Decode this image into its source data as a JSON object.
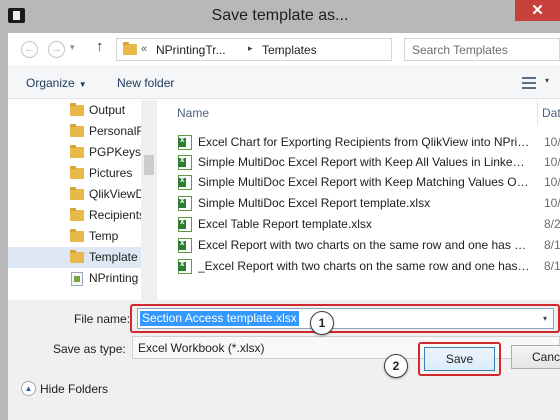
{
  "window": {
    "title": "Save template as...",
    "close_glyph": "✕"
  },
  "addressbar": {
    "back_glyph": "←",
    "forward_glyph": "→",
    "recent_glyph": "▾",
    "up_glyph": "↑",
    "overflow": "«",
    "crumbs": [
      "NPrintingTr...",
      "Templates"
    ],
    "crumb_separator": "▸",
    "dropdown_glyph": "▾",
    "refresh_glyph": "↻",
    "search_placeholder": "Search Templates"
  },
  "toolbar": {
    "organize_label": "Organize",
    "organize_caret": "▼",
    "new_folder_label": "New folder",
    "view_caret": "▾"
  },
  "nav_pane": {
    "items": [
      {
        "label": "Output",
        "icon": "folder-icon",
        "selected": false
      },
      {
        "label": "PersonalF",
        "icon": "folder-icon",
        "selected": false
      },
      {
        "label": "PGPKeys",
        "icon": "folder-icon",
        "selected": false
      },
      {
        "label": "Pictures",
        "icon": "folder-icon",
        "selected": false
      },
      {
        "label": "QlikViewD",
        "icon": "folder-icon",
        "selected": false
      },
      {
        "label": "Recipients",
        "icon": "folder-icon",
        "selected": false
      },
      {
        "label": "Temp",
        "icon": "folder-icon",
        "selected": false
      },
      {
        "label": "Template",
        "icon": "folder-icon",
        "selected": true
      },
      {
        "label": "NPrinting",
        "icon": "nprinting-file-icon",
        "selected": false
      }
    ]
  },
  "file_list": {
    "columns": {
      "name": "Name",
      "date": "Dat"
    },
    "files": [
      {
        "name": "Excel Chart for Exporting Recipients from QlikView into NPrin...",
        "date": "10/"
      },
      {
        "name": "Simple MultiDoc Excel Report with Keep All Values in Linked ...",
        "date": "10/"
      },
      {
        "name": "Simple MultiDoc Excel Report with Keep Matching Values Onl...",
        "date": "10/"
      },
      {
        "name": "Simple MultiDoc Excel Report template.xlsx",
        "date": "10/"
      },
      {
        "name": "Excel Table Report template.xlsx",
        "date": "8/2"
      },
      {
        "name": "Excel Report with two charts on the same row and one has ex...",
        "date": "8/1"
      },
      {
        "name": "_Excel Report with two charts on the same row and one has e...",
        "date": "8/1"
      }
    ]
  },
  "form": {
    "file_name_label": "File name:",
    "file_name_value": "Section Access template.xlsx",
    "file_name_caret": "▾",
    "save_as_type_label": "Save as type:",
    "save_as_type_value": "Excel Workbook (*.xlsx)",
    "callout_1": "1",
    "callout_2": "2"
  },
  "footer": {
    "hide_folders_glyph": "▲",
    "hide_folders_label": "Hide Folders",
    "save_label": "Save",
    "cancel_label": "Cancel"
  },
  "colors": {
    "titlebar": "#b8b8b8",
    "close_button": "#c7413c",
    "highlight_outline": "#d0282e",
    "selection": "#3399ff",
    "bottom_panel": "#f0f0f0"
  }
}
